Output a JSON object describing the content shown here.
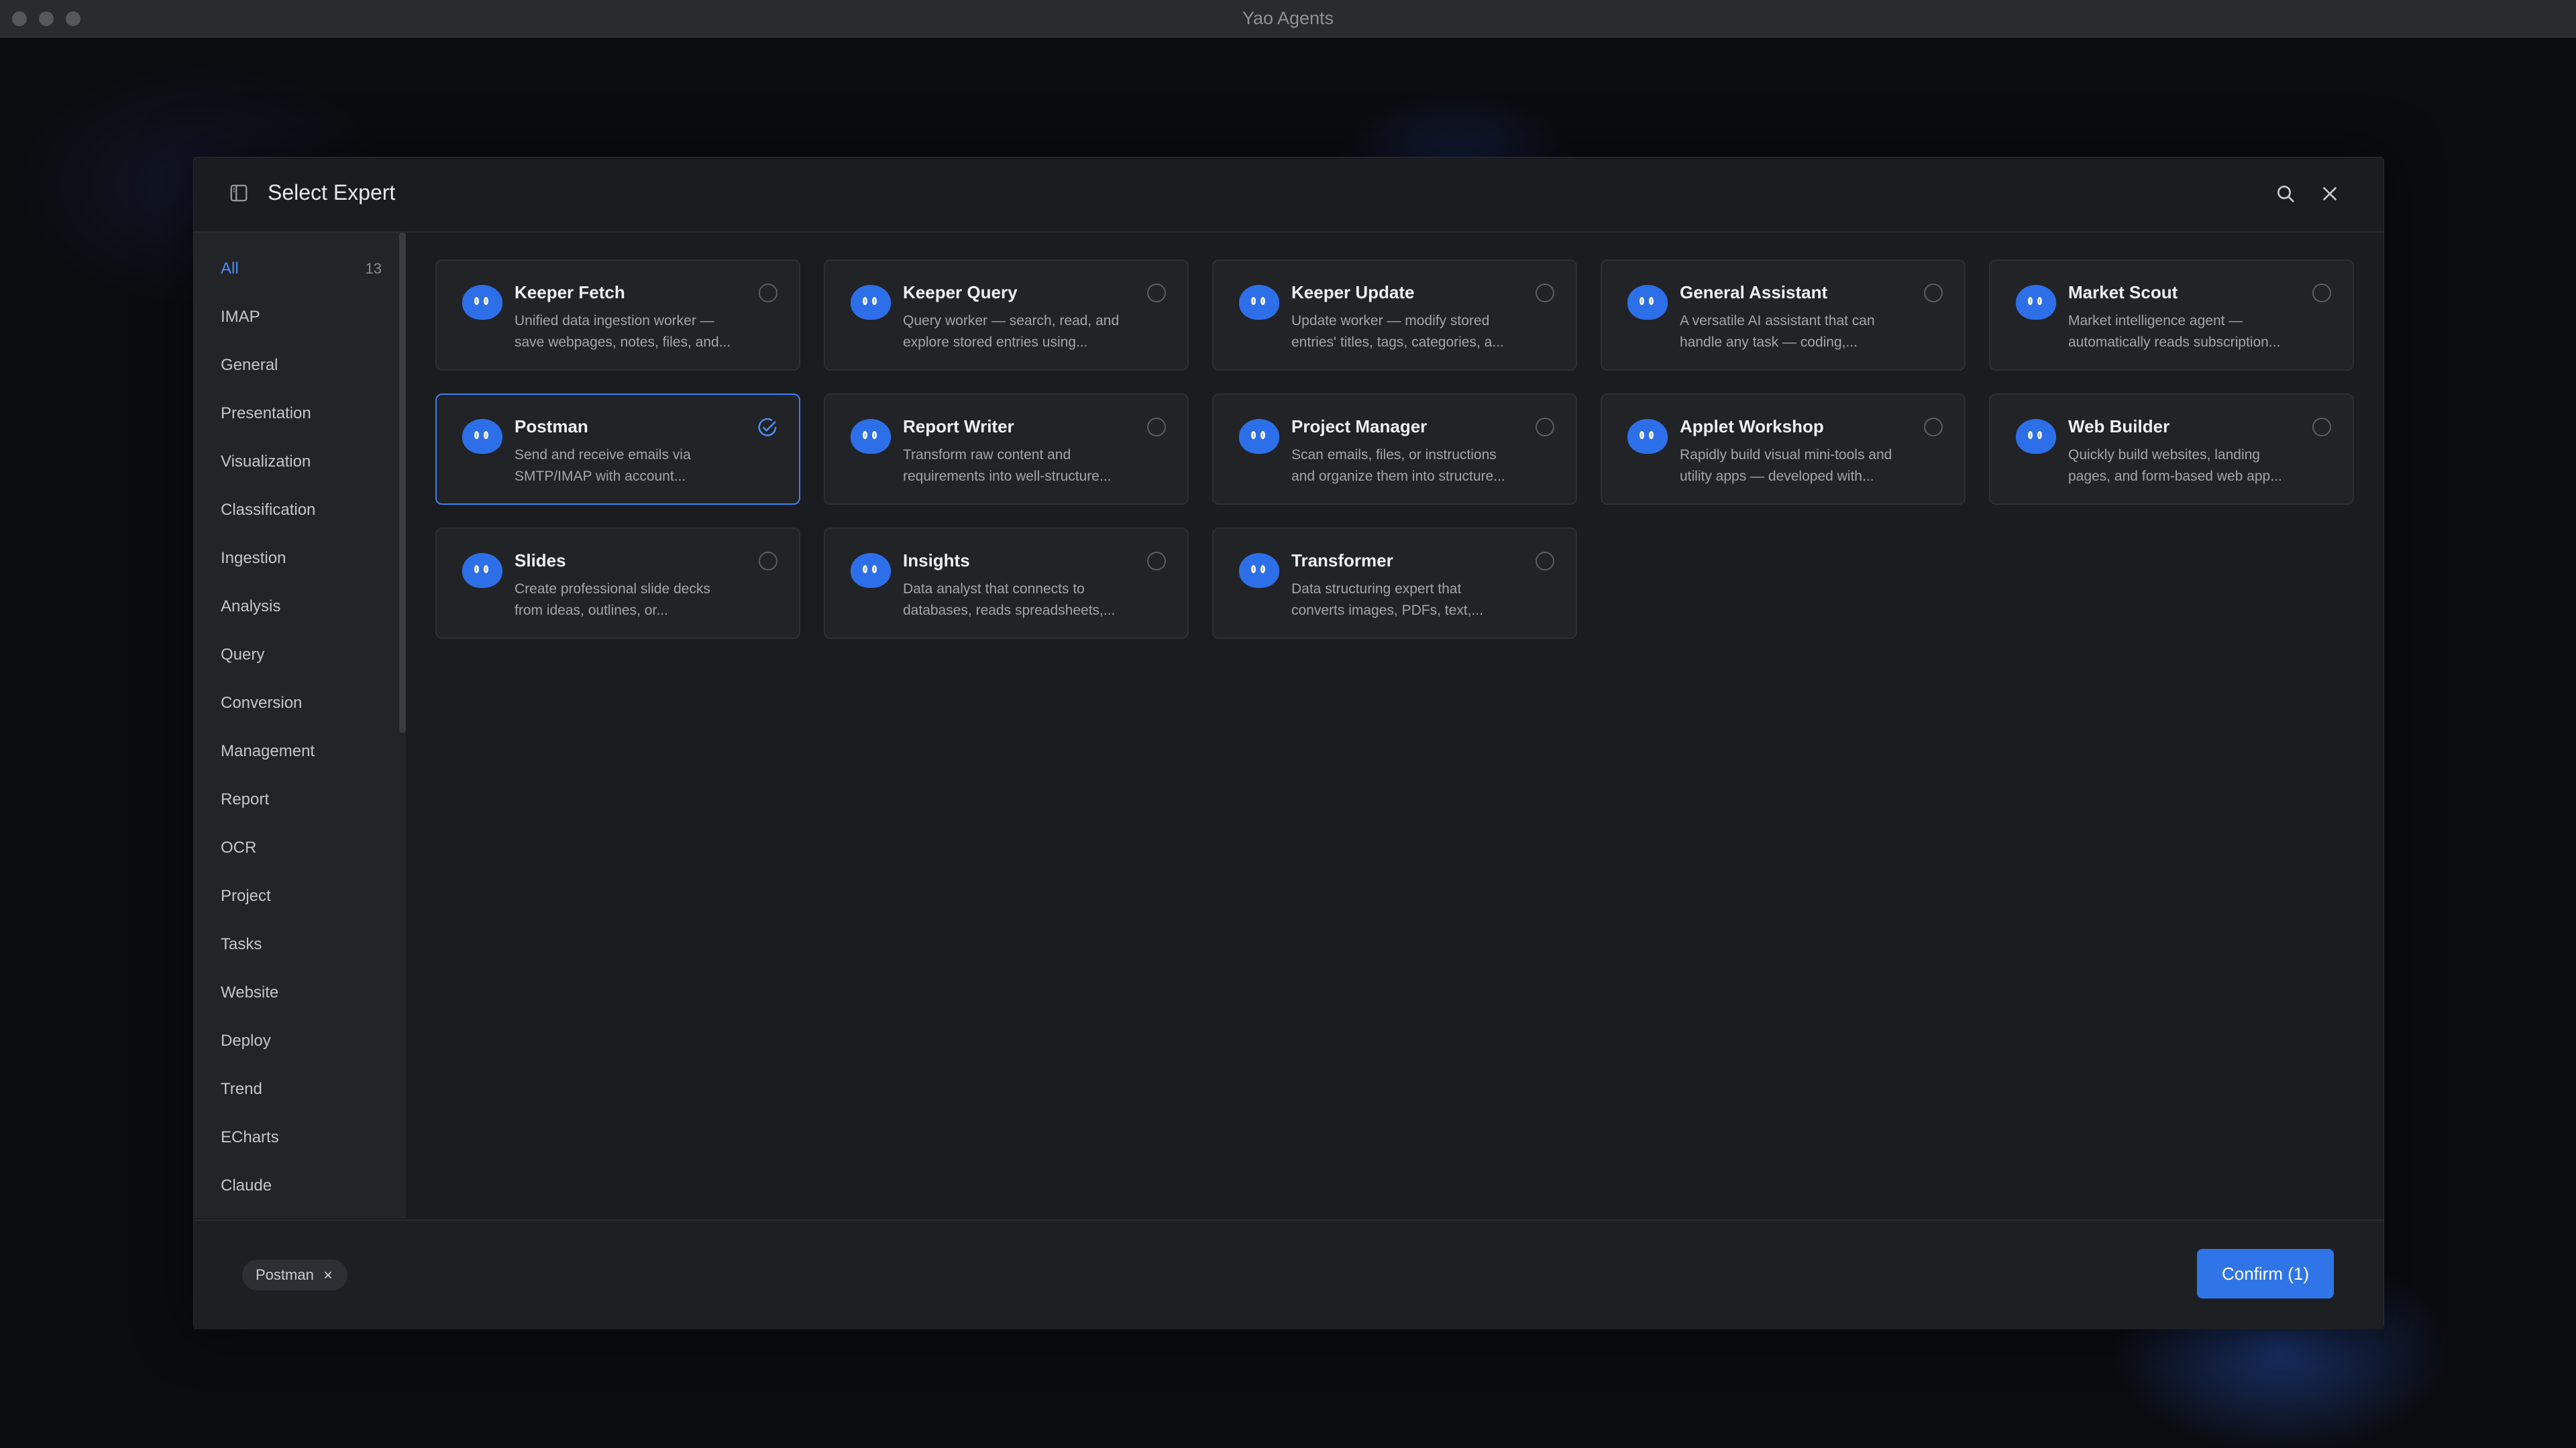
{
  "window": {
    "title": "Yao Agents"
  },
  "modal": {
    "title": "Select Expert"
  },
  "categories": [
    {
      "label": "All",
      "count": "13"
    },
    {
      "label": "IMAP"
    },
    {
      "label": "General"
    },
    {
      "label": "Presentation"
    },
    {
      "label": "Visualization"
    },
    {
      "label": "Classification"
    },
    {
      "label": "Ingestion"
    },
    {
      "label": "Analysis"
    },
    {
      "label": "Query"
    },
    {
      "label": "Conversion"
    },
    {
      "label": "Management"
    },
    {
      "label": "Report"
    },
    {
      "label": "OCR"
    },
    {
      "label": "Project"
    },
    {
      "label": "Tasks"
    },
    {
      "label": "Website"
    },
    {
      "label": "Deploy"
    },
    {
      "label": "Trend"
    },
    {
      "label": "ECharts"
    },
    {
      "label": "Claude"
    }
  ],
  "experts": [
    {
      "name": "Keeper Fetch",
      "desc_line1": "Unified data ingestion worker —",
      "desc_line2": "save webpages, notes, files, and...",
      "selected": false
    },
    {
      "name": "Keeper Query",
      "desc_line1": "Query worker — search, read, and",
      "desc_line2": "explore stored entries using...",
      "selected": false
    },
    {
      "name": "Keeper Update",
      "desc_line1": "Update worker — modify stored",
      "desc_line2": "entries' titles, tags, categories, a...",
      "selected": false
    },
    {
      "name": "General Assistant",
      "desc_line1": "A versatile AI assistant that can",
      "desc_line2": "handle any task — coding,...",
      "selected": false
    },
    {
      "name": "Market Scout",
      "desc_line1": "Market intelligence agent —",
      "desc_line2": "automatically reads subscription...",
      "selected": false
    },
    {
      "name": "Postman",
      "desc_line1": "Send and receive emails via",
      "desc_line2": "SMTP/IMAP with account...",
      "selected": true
    },
    {
      "name": "Report Writer",
      "desc_line1": "Transform raw content and",
      "desc_line2": "requirements into well-structure...",
      "selected": false
    },
    {
      "name": "Project Manager",
      "desc_line1": "Scan emails, files, or instructions",
      "desc_line2": "and organize them into structure...",
      "selected": false
    },
    {
      "name": "Applet Workshop",
      "desc_line1": "Rapidly build visual mini-tools and",
      "desc_line2": "utility apps — developed with...",
      "selected": false
    },
    {
      "name": "Web Builder",
      "desc_line1": "Quickly build websites, landing",
      "desc_line2": "pages, and form-based web app...",
      "selected": false
    },
    {
      "name": "Slides",
      "desc_line1": "Create professional slide decks",
      "desc_line2": "from ideas, outlines, or...",
      "selected": false
    },
    {
      "name": "Insights",
      "desc_line1": "Data analyst that connects to",
      "desc_line2": "databases, reads spreadsheets,...",
      "selected": false
    },
    {
      "name": "Transformer",
      "desc_line1": "Data structuring expert that",
      "desc_line2": "converts images, PDFs, text,...",
      "selected": false
    }
  ],
  "footer": {
    "selected_chip": "Postman",
    "confirm_label": "Confirm (1)"
  },
  "colors": {
    "accent": "#2f75e8",
    "selected_border": "#3b7ff0",
    "active_category": "#4a8df7"
  },
  "icons": {
    "sidebar_toggle": "sidebar-toggle-icon",
    "search": "search-icon",
    "close": "close-icon",
    "avatar": "robot-avatar-icon",
    "radio": "radio-unchecked-icon",
    "check": "check-circle-icon"
  }
}
